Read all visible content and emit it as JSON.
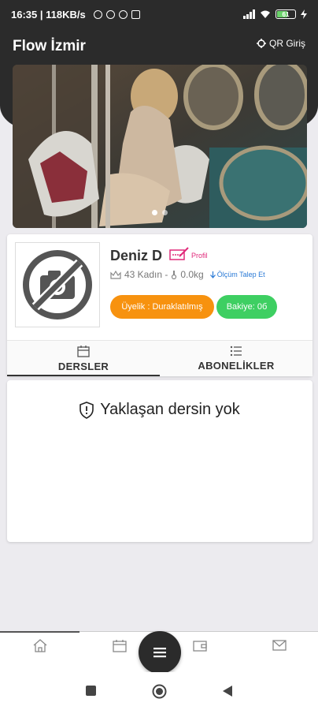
{
  "status_bar": {
    "time_speed": "16:35 | 118KB/s",
    "battery_level": "61"
  },
  "header": {
    "title": "Flow İzmir",
    "qr_label": "QR Giriş"
  },
  "banner": {
    "slides": 2,
    "active_slide": 1
  },
  "profile": {
    "name": "Deniz D",
    "edit_label": "Profil",
    "age_gender": "43 Kadın -",
    "weight": "0.0kg",
    "measure_request": "Ölçüm Talep Et",
    "membership_status": "Üyelik : Duraklatılmış",
    "balance": "Bakiye: 0б"
  },
  "tabs": [
    {
      "label": "DERSLER",
      "icon": "calendar-icon",
      "active": true
    },
    {
      "label": "ABONELİKLER",
      "icon": "list-icon",
      "active": false
    }
  ],
  "lessons": {
    "empty_message": "Yaklaşan dersin yok"
  },
  "bottom_nav": {
    "items": [
      "home-icon",
      "calendar-icon",
      "wallet-icon",
      "mail-icon"
    ],
    "center": "menu-icon"
  },
  "colors": {
    "dark": "#2b2b2b",
    "orange": "#f7920f",
    "green": "#3ecf62",
    "pink": "#e02a7a",
    "link_blue": "#2a7ad6"
  }
}
